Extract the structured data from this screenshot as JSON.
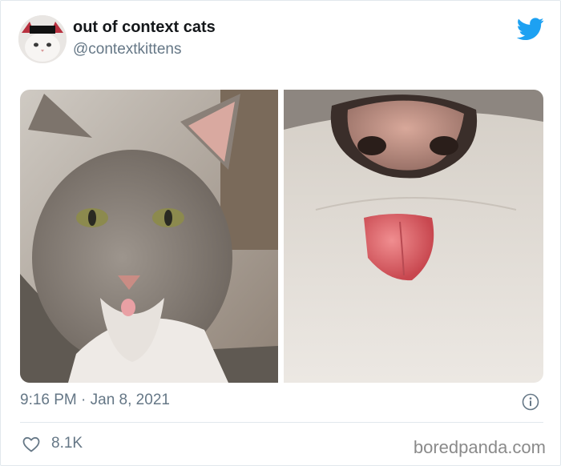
{
  "tweet": {
    "display_name": "out of context cats",
    "handle": "@contextkittens",
    "timestamp": "9:16 PM · Jan 8, 2021",
    "likes": "8.1K"
  },
  "icons": {
    "logo": "twitter-bird-icon",
    "info": "info-icon",
    "like": "heart-icon"
  },
  "media": [
    {
      "subject": "grey tabby cat with tongue tip out"
    },
    {
      "subject": "close-up of cat nose and tongue"
    }
  ],
  "watermark": "boredpanda.com",
  "colors": {
    "twitter_blue": "#1da1f2",
    "muted_text": "#657786",
    "main_text": "#14171a"
  }
}
